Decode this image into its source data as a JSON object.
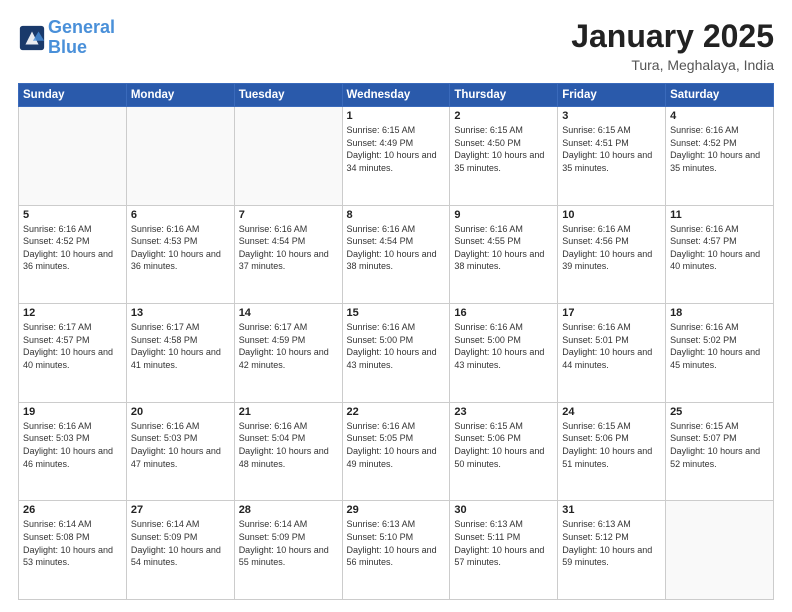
{
  "header": {
    "logo_line1": "General",
    "logo_line2": "Blue",
    "month": "January 2025",
    "location": "Tura, Meghalaya, India"
  },
  "weekdays": [
    "Sunday",
    "Monday",
    "Tuesday",
    "Wednesday",
    "Thursday",
    "Friday",
    "Saturday"
  ],
  "weeks": [
    [
      {
        "day": "",
        "sunrise": "",
        "sunset": "",
        "daylight": "",
        "empty": true
      },
      {
        "day": "",
        "sunrise": "",
        "sunset": "",
        "daylight": "",
        "empty": true
      },
      {
        "day": "",
        "sunrise": "",
        "sunset": "",
        "daylight": "",
        "empty": true
      },
      {
        "day": "1",
        "sunrise": "Sunrise: 6:15 AM",
        "sunset": "Sunset: 4:49 PM",
        "daylight": "Daylight: 10 hours and 34 minutes.",
        "empty": false
      },
      {
        "day": "2",
        "sunrise": "Sunrise: 6:15 AM",
        "sunset": "Sunset: 4:50 PM",
        "daylight": "Daylight: 10 hours and 35 minutes.",
        "empty": false
      },
      {
        "day": "3",
        "sunrise": "Sunrise: 6:15 AM",
        "sunset": "Sunset: 4:51 PM",
        "daylight": "Daylight: 10 hours and 35 minutes.",
        "empty": false
      },
      {
        "day": "4",
        "sunrise": "Sunrise: 6:16 AM",
        "sunset": "Sunset: 4:52 PM",
        "daylight": "Daylight: 10 hours and 35 minutes.",
        "empty": false
      }
    ],
    [
      {
        "day": "5",
        "sunrise": "Sunrise: 6:16 AM",
        "sunset": "Sunset: 4:52 PM",
        "daylight": "Daylight: 10 hours and 36 minutes.",
        "empty": false
      },
      {
        "day": "6",
        "sunrise": "Sunrise: 6:16 AM",
        "sunset": "Sunset: 4:53 PM",
        "daylight": "Daylight: 10 hours and 36 minutes.",
        "empty": false
      },
      {
        "day": "7",
        "sunrise": "Sunrise: 6:16 AM",
        "sunset": "Sunset: 4:54 PM",
        "daylight": "Daylight: 10 hours and 37 minutes.",
        "empty": false
      },
      {
        "day": "8",
        "sunrise": "Sunrise: 6:16 AM",
        "sunset": "Sunset: 4:54 PM",
        "daylight": "Daylight: 10 hours and 38 minutes.",
        "empty": false
      },
      {
        "day": "9",
        "sunrise": "Sunrise: 6:16 AM",
        "sunset": "Sunset: 4:55 PM",
        "daylight": "Daylight: 10 hours and 38 minutes.",
        "empty": false
      },
      {
        "day": "10",
        "sunrise": "Sunrise: 6:16 AM",
        "sunset": "Sunset: 4:56 PM",
        "daylight": "Daylight: 10 hours and 39 minutes.",
        "empty": false
      },
      {
        "day": "11",
        "sunrise": "Sunrise: 6:16 AM",
        "sunset": "Sunset: 4:57 PM",
        "daylight": "Daylight: 10 hours and 40 minutes.",
        "empty": false
      }
    ],
    [
      {
        "day": "12",
        "sunrise": "Sunrise: 6:17 AM",
        "sunset": "Sunset: 4:57 PM",
        "daylight": "Daylight: 10 hours and 40 minutes.",
        "empty": false
      },
      {
        "day": "13",
        "sunrise": "Sunrise: 6:17 AM",
        "sunset": "Sunset: 4:58 PM",
        "daylight": "Daylight: 10 hours and 41 minutes.",
        "empty": false
      },
      {
        "day": "14",
        "sunrise": "Sunrise: 6:17 AM",
        "sunset": "Sunset: 4:59 PM",
        "daylight": "Daylight: 10 hours and 42 minutes.",
        "empty": false
      },
      {
        "day": "15",
        "sunrise": "Sunrise: 6:16 AM",
        "sunset": "Sunset: 5:00 PM",
        "daylight": "Daylight: 10 hours and 43 minutes.",
        "empty": false
      },
      {
        "day": "16",
        "sunrise": "Sunrise: 6:16 AM",
        "sunset": "Sunset: 5:00 PM",
        "daylight": "Daylight: 10 hours and 43 minutes.",
        "empty": false
      },
      {
        "day": "17",
        "sunrise": "Sunrise: 6:16 AM",
        "sunset": "Sunset: 5:01 PM",
        "daylight": "Daylight: 10 hours and 44 minutes.",
        "empty": false
      },
      {
        "day": "18",
        "sunrise": "Sunrise: 6:16 AM",
        "sunset": "Sunset: 5:02 PM",
        "daylight": "Daylight: 10 hours and 45 minutes.",
        "empty": false
      }
    ],
    [
      {
        "day": "19",
        "sunrise": "Sunrise: 6:16 AM",
        "sunset": "Sunset: 5:03 PM",
        "daylight": "Daylight: 10 hours and 46 minutes.",
        "empty": false
      },
      {
        "day": "20",
        "sunrise": "Sunrise: 6:16 AM",
        "sunset": "Sunset: 5:03 PM",
        "daylight": "Daylight: 10 hours and 47 minutes.",
        "empty": false
      },
      {
        "day": "21",
        "sunrise": "Sunrise: 6:16 AM",
        "sunset": "Sunset: 5:04 PM",
        "daylight": "Daylight: 10 hours and 48 minutes.",
        "empty": false
      },
      {
        "day": "22",
        "sunrise": "Sunrise: 6:16 AM",
        "sunset": "Sunset: 5:05 PM",
        "daylight": "Daylight: 10 hours and 49 minutes.",
        "empty": false
      },
      {
        "day": "23",
        "sunrise": "Sunrise: 6:15 AM",
        "sunset": "Sunset: 5:06 PM",
        "daylight": "Daylight: 10 hours and 50 minutes.",
        "empty": false
      },
      {
        "day": "24",
        "sunrise": "Sunrise: 6:15 AM",
        "sunset": "Sunset: 5:06 PM",
        "daylight": "Daylight: 10 hours and 51 minutes.",
        "empty": false
      },
      {
        "day": "25",
        "sunrise": "Sunrise: 6:15 AM",
        "sunset": "Sunset: 5:07 PM",
        "daylight": "Daylight: 10 hours and 52 minutes.",
        "empty": false
      }
    ],
    [
      {
        "day": "26",
        "sunrise": "Sunrise: 6:14 AM",
        "sunset": "Sunset: 5:08 PM",
        "daylight": "Daylight: 10 hours and 53 minutes.",
        "empty": false
      },
      {
        "day": "27",
        "sunrise": "Sunrise: 6:14 AM",
        "sunset": "Sunset: 5:09 PM",
        "daylight": "Daylight: 10 hours and 54 minutes.",
        "empty": false
      },
      {
        "day": "28",
        "sunrise": "Sunrise: 6:14 AM",
        "sunset": "Sunset: 5:09 PM",
        "daylight": "Daylight: 10 hours and 55 minutes.",
        "empty": false
      },
      {
        "day": "29",
        "sunrise": "Sunrise: 6:13 AM",
        "sunset": "Sunset: 5:10 PM",
        "daylight": "Daylight: 10 hours and 56 minutes.",
        "empty": false
      },
      {
        "day": "30",
        "sunrise": "Sunrise: 6:13 AM",
        "sunset": "Sunset: 5:11 PM",
        "daylight": "Daylight: 10 hours and 57 minutes.",
        "empty": false
      },
      {
        "day": "31",
        "sunrise": "Sunrise: 6:13 AM",
        "sunset": "Sunset: 5:12 PM",
        "daylight": "Daylight: 10 hours and 59 minutes.",
        "empty": false
      },
      {
        "day": "",
        "sunrise": "",
        "sunset": "",
        "daylight": "",
        "empty": true
      }
    ]
  ]
}
